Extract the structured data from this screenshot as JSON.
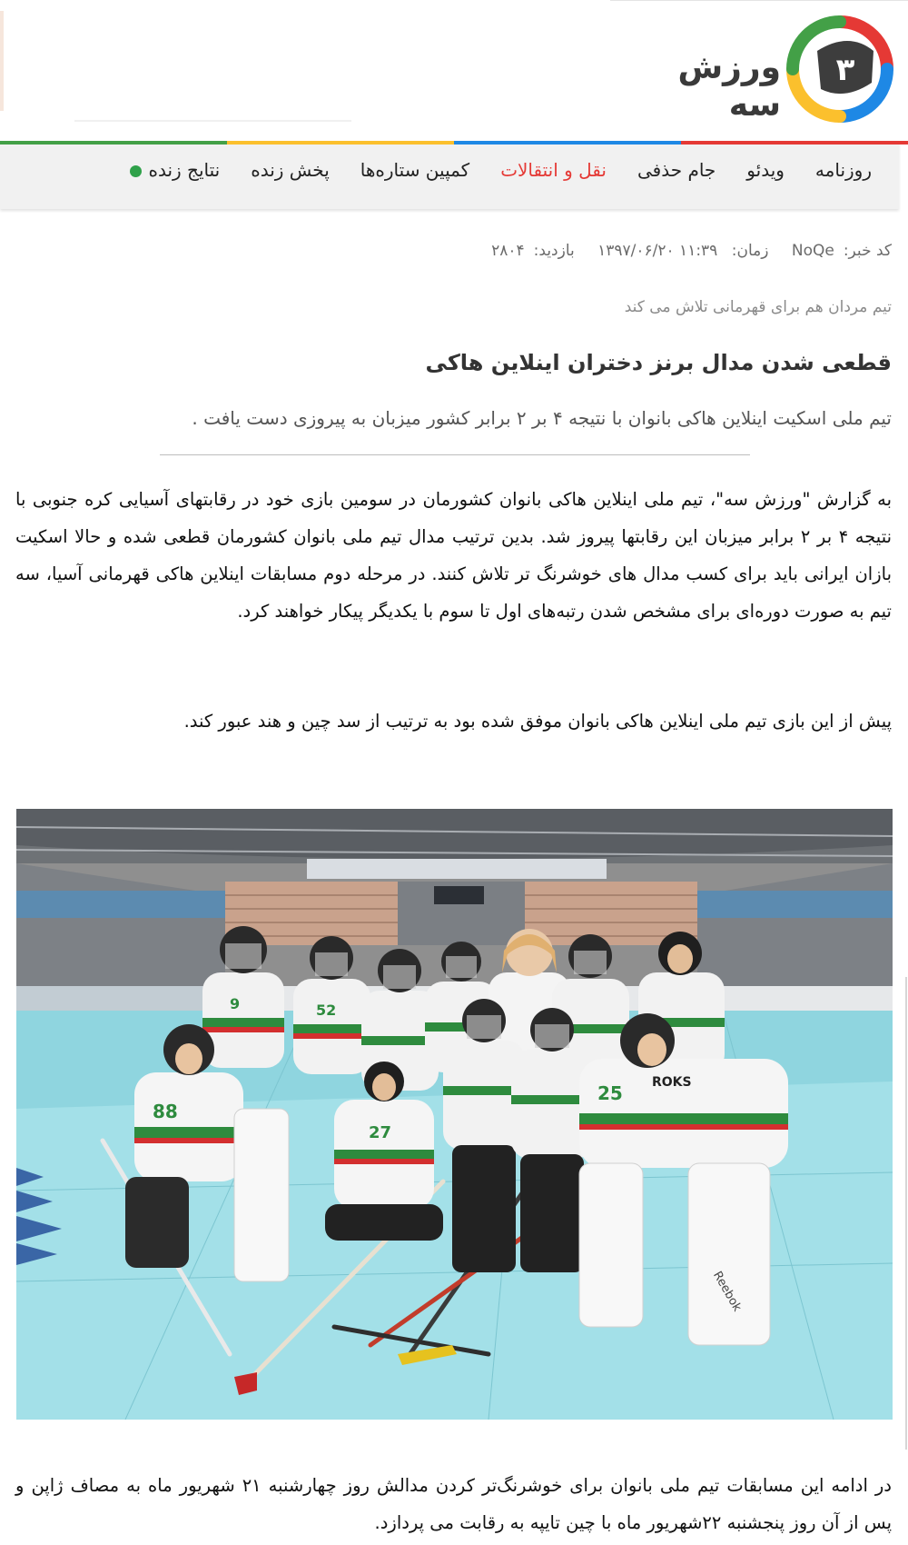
{
  "site": {
    "logo_text": "ورزش سه",
    "logo_digit": "۳",
    "colors": {
      "accent_red": "#e53935",
      "live_green": "#2fa14a",
      "logo_dark": "#3a3a3a"
    }
  },
  "nav": {
    "items": [
      {
        "label": "روزنامه"
      },
      {
        "label": "ویدئو"
      },
      {
        "label": "جام حذفی"
      },
      {
        "label": "نقل و انتقالات",
        "highlight": true
      },
      {
        "label": "کمپین ستاره‌ها"
      },
      {
        "label": "پخش زنده"
      },
      {
        "label": "نتایج زنده"
      }
    ],
    "stripe_colors": [
      "#43a047",
      "#fbc02d",
      "#1e88e5",
      "#e53935"
    ]
  },
  "article": {
    "meta": {
      "code_label": "کد خبر:",
      "code_value": "NoQe",
      "time_label": "زمان:",
      "time_value": "۱۳۹۷/۰۶/۲۰ ۱۱:۳۹",
      "visits_label": "بازدید:",
      "visits_value": "۲۸۰۴"
    },
    "subtitle": "تیم مردان هم برای قهرمانی تلاش می کند",
    "headline": "قطعی شدن مدال برنز دختران اینلاین هاکی",
    "lead": "تیم ملی اسکیت اینلاین هاکی بانوان با نتیجه ۴ بر ۲ برابر کشور میزبان به پیروزی دست یافت .",
    "paragraphs": [
      "به گزارش \"ورزش سه\"، تیم ملی اینلاین هاکی بانوان کشورمان در سومین بازی خود در رقابتهای آسیایی کره جنوبی با نتیجه ۴ بر ۲ برابر میزبان این رقابتها پیروز شد. بدین ترتیب مدال تیم ملی بانوان کشورمان قطعی شده و حالا اسکیت بازان ایرانی باید برای کسب مدال های خوشرنگ تر تلاش کنند. در مرحله دوم مسابقات اینلاین هاکی قهرمانی آسیا، سه تیم به صورت دوره‌ای برای مشخص شدن رتبه‌های اول تا سوم با یکدیگر پیکار خواهند کرد.",
      "پیش از این بازی تیم ملی اینلاین هاکی بانوان موفق شده بود به ترتیب از سد چین و هند عبور کند.",
      "در ادامه این مسابقات تیم ملی بانوان برای خوشرنگ‌تر کردن مدالش روز چهارشنبه ۲۱ شهریور ماه به مصاف ژاپن و پس از آن روز پنجشنبه ۲۲شهریور ماه با چین تایپه به رقابت می پردازد."
    ],
    "photo": {
      "jersey_numbers": [
        "9",
        "52",
        "88",
        "27",
        "25"
      ],
      "jersey_text": "ROKS",
      "arena_sign": "Reebok"
    }
  }
}
